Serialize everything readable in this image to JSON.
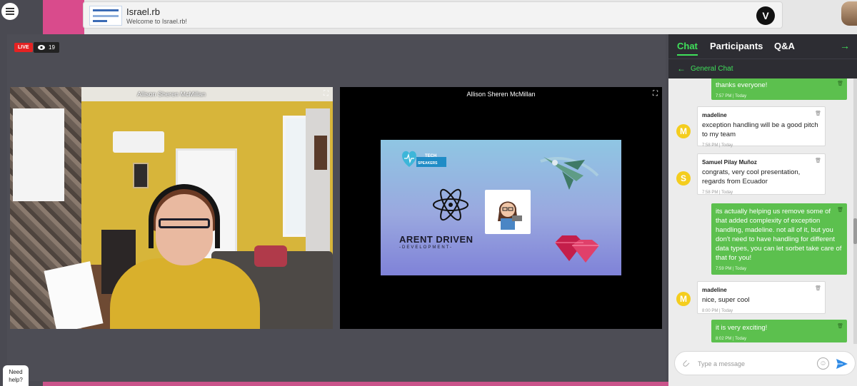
{
  "header": {
    "title": "Israel.rb",
    "subtitle": "Welcome to Israel.rb!",
    "logo_letter": "V"
  },
  "stream": {
    "live_label": "LIVE",
    "viewer_count": "19"
  },
  "tiles": [
    {
      "name": "Allison Sheren McMillan"
    },
    {
      "name": "Allison Sheren McMillan"
    }
  ],
  "slide": {
    "tech_label": "TECH",
    "speakers_label": "SPEAKERS",
    "pdd_title": "ARENT DRIVEN",
    "pdd_sub": "-DEVELOPMENT-"
  },
  "panel": {
    "tabs": [
      {
        "label": "Chat",
        "active": true
      },
      {
        "label": "Participants",
        "active": false
      },
      {
        "label": "Q&A",
        "active": false
      }
    ],
    "channel": "General Chat"
  },
  "messages": [
    {
      "side": "out",
      "text": "thanks everyone!",
      "time": "7:57 PM | Today"
    },
    {
      "side": "in",
      "sender": "madeline",
      "initial": "M",
      "text": "exception handling will be a good pitch to my team",
      "time": "7:58 PM | Today"
    },
    {
      "side": "in",
      "sender": "Samuel Pilay Muñoz",
      "initial": "S",
      "text": "congrats, very  cool presentation, regards from Ecuador",
      "time": "7:58 PM | Today"
    },
    {
      "side": "out",
      "text": "its actually helping us remove some of that added complexity of exception handling, madeline. not all of it, but you don't need to have handling for different data types, you can let sorbet take care of that for you!",
      "time": "7:59 PM | Today"
    },
    {
      "side": "in",
      "sender": "madeline",
      "initial": "M",
      "text": "nice, super cool",
      "time": "8:00 PM | Today"
    },
    {
      "side": "out",
      "text": "it is very exciting!",
      "time": "8:02 PM | Today"
    }
  ],
  "composer": {
    "placeholder": "Type a message"
  },
  "help": {
    "label_line1": "Need",
    "label_line2": "help?"
  },
  "colors": {
    "accent_green": "#3fe05a",
    "bubble_green": "#5cc04e",
    "live_red": "#e52222",
    "avatar_yellow": "#f4cd1e"
  }
}
